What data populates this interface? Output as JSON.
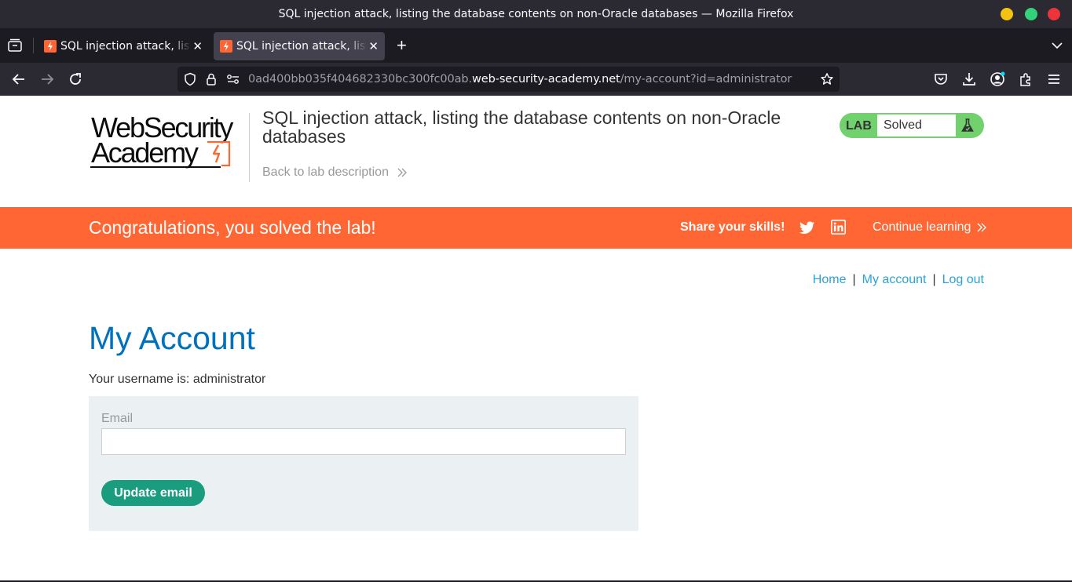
{
  "window": {
    "title": "SQL injection attack, listing the database contents on non-Oracle databases — Mozilla Firefox"
  },
  "tabs": [
    {
      "label": "SQL injection attack, listing the database contents on non-Oracle databases",
      "icon": "portswigger-favicon"
    },
    {
      "label": "SQL injection attack, listing the database contents on non-Oracle databases",
      "icon": "portswigger-favicon",
      "active": true
    }
  ],
  "urlbar": {
    "prefix": "0ad400bb035f404682330bc300fc00ab.",
    "host": "web-security-academy.net",
    "path": "/my-account?id=administrator"
  },
  "header": {
    "logo_line1": "WebSecurity",
    "logo_line2": "Academy",
    "lab_title": "SQL injection attack, listing the database contents on non-Oracle databases",
    "back_link": "Back to lab description",
    "lab_label": "LAB",
    "lab_status": "Solved"
  },
  "banner": {
    "message": "Congratulations, you solved the lab!",
    "share": "Share your skills!",
    "continue": "Continue learning"
  },
  "nav": {
    "home": "Home",
    "separator": "|",
    "my_account": "My account",
    "logout": "Log out"
  },
  "main": {
    "heading": "My Account",
    "username_text": "Your username is: administrator",
    "email_label": "Email",
    "email_value": "",
    "update_button": "Update email"
  },
  "colors": {
    "accent_orange": "#ff6633",
    "heading_blue": "#0071bc",
    "link_blue": "#29a3d8",
    "button_green": "#1a9c7e",
    "status_green": "#70d16d"
  }
}
